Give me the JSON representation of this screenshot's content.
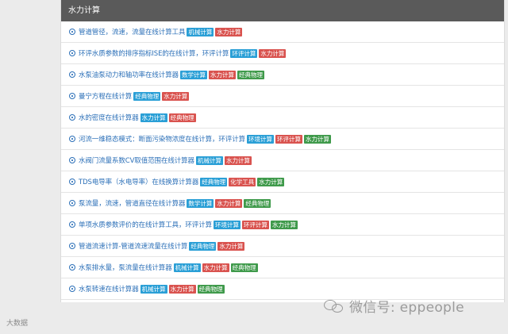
{
  "header": {
    "title": "水力计算"
  },
  "colors": {
    "blue": "#2a9fd6",
    "red": "#d9534f",
    "green": "#3f9a4b",
    "link": "#2c70b8"
  },
  "items": [
    {
      "label": "管道管径，流速，流量在线计算工具",
      "tags": [
        {
          "text": "机械计算",
          "color": "blue"
        },
        {
          "text": "水力计算",
          "color": "red"
        }
      ]
    },
    {
      "label": "环评水质参数的排序指标ISE的在线计算，环评计算",
      "tags": [
        {
          "text": "环评计算",
          "color": "blue"
        },
        {
          "text": "水力计算",
          "color": "red"
        }
      ]
    },
    {
      "label": "水泵油泵动力和轴功率在线计算器",
      "tags": [
        {
          "text": "数学计算",
          "color": "blue"
        },
        {
          "text": "水力计算",
          "color": "red"
        },
        {
          "text": "经典物理",
          "color": "green"
        }
      ]
    },
    {
      "label": "曼宁方程在线计算",
      "tags": [
        {
          "text": "经典物理",
          "color": "blue"
        },
        {
          "text": "水力计算",
          "color": "red"
        }
      ]
    },
    {
      "label": "水的密度在线计算器",
      "tags": [
        {
          "text": "水力计算",
          "color": "blue"
        },
        {
          "text": "经典物理",
          "color": "red"
        }
      ]
    },
    {
      "label": "河流一维稳态模式：断面污染物浓度在线计算，环评计算",
      "tags": [
        {
          "text": "环境计算",
          "color": "blue"
        },
        {
          "text": "环评计算",
          "color": "red"
        },
        {
          "text": "水力计算",
          "color": "green"
        }
      ]
    },
    {
      "label": "水阀门流量系数CV取值范围在线计算器",
      "tags": [
        {
          "text": "机械计算",
          "color": "blue"
        },
        {
          "text": "水力计算",
          "color": "red"
        }
      ]
    },
    {
      "label": "TDS电导率（水电导率）在线换算计算器",
      "tags": [
        {
          "text": "经典物理",
          "color": "blue"
        },
        {
          "text": "化学工具",
          "color": "red"
        },
        {
          "text": "水力计算",
          "color": "green"
        }
      ]
    },
    {
      "label": "泵流量，流速，管道直径在线计算器",
      "tags": [
        {
          "text": "数学计算",
          "color": "blue"
        },
        {
          "text": "水力计算",
          "color": "red"
        },
        {
          "text": "经典物理",
          "color": "green"
        }
      ]
    },
    {
      "label": "单项水质参数评价的在线计算工具，环评计算",
      "tags": [
        {
          "text": "环境计算",
          "color": "blue"
        },
        {
          "text": "环评计算",
          "color": "red"
        },
        {
          "text": "水力计算",
          "color": "green"
        }
      ]
    },
    {
      "label": "管道流速计算-管道流速流量在线计算",
      "tags": [
        {
          "text": "经典物理",
          "color": "blue"
        },
        {
          "text": "水力计算",
          "color": "red"
        }
      ]
    },
    {
      "label": "水泵排水量，泵流量在线计算器",
      "tags": [
        {
          "text": "机械计算",
          "color": "blue"
        },
        {
          "text": "水力计算",
          "color": "red"
        },
        {
          "text": "经典物理",
          "color": "green"
        }
      ]
    },
    {
      "label": "水泵转速在线计算器",
      "tags": [
        {
          "text": "机械计算",
          "color": "blue"
        },
        {
          "text": "水力计算",
          "color": "red"
        },
        {
          "text": "经典物理",
          "color": "green"
        }
      ]
    }
  ],
  "watermarks": {
    "left": "大数据",
    "right": "微信号: eppeople",
    "right_icon": "wechat-icon"
  }
}
